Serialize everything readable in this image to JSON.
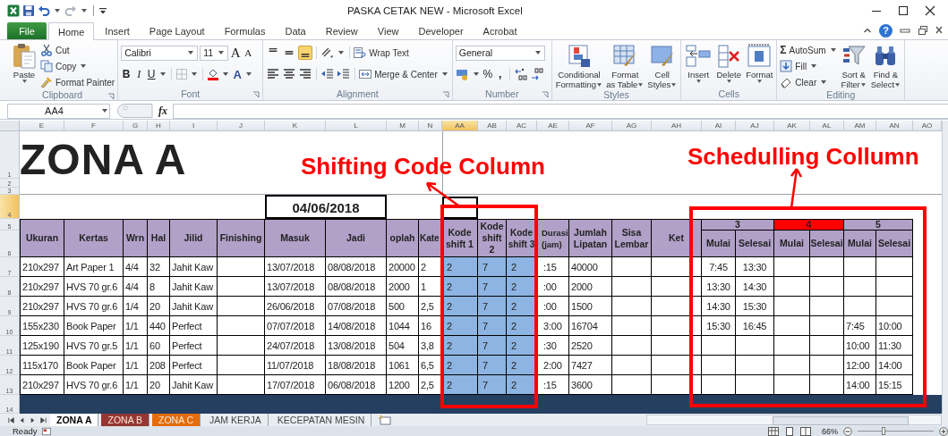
{
  "window": {
    "title": "PASKA CETAK NEW  -  Microsoft Excel"
  },
  "ribbon_tabs": [
    {
      "label": "File",
      "kind": "file",
      "selected": false
    },
    {
      "label": "Home",
      "kind": "tab",
      "selected": true
    },
    {
      "label": "Insert",
      "kind": "tab",
      "selected": false
    },
    {
      "label": "Page Layout",
      "kind": "tab",
      "selected": false
    },
    {
      "label": "Formulas",
      "kind": "tab",
      "selected": false
    },
    {
      "label": "Data",
      "kind": "tab",
      "selected": false
    },
    {
      "label": "Review",
      "kind": "tab",
      "selected": false
    },
    {
      "label": "View",
      "kind": "tab",
      "selected": false
    },
    {
      "label": "Developer",
      "kind": "tab",
      "selected": false
    },
    {
      "label": "Acrobat",
      "kind": "tab",
      "selected": false
    }
  ],
  "help": "?",
  "clipboard": {
    "label": "Clipboard",
    "paste": "Paste",
    "cut": "Cut",
    "copy": "Copy",
    "format_painter": "Format Painter"
  },
  "font": {
    "label": "Font",
    "name": "Calibri",
    "size": "11",
    "grow": "A",
    "shrink": "A",
    "bold": "B",
    "italic": "I",
    "underline": "U",
    "tint_letter": "A"
  },
  "alignment": {
    "label": "Alignment",
    "wrap_text": "Wrap Text",
    "merge": "Merge & Center",
    "vertical": [
      {
        "selected": false
      },
      {
        "selected": false
      },
      {
        "selected": true
      }
    ]
  },
  "number": {
    "label": "Number",
    "format": "General",
    "percent": "%",
    "comma": ","
  },
  "styles": {
    "label": "Styles",
    "buttons": [
      [
        "Conditional",
        "Formatting"
      ],
      [
        "Format",
        "as Table"
      ],
      [
        "Cell",
        "Styles"
      ]
    ]
  },
  "cells": {
    "label": "Cells",
    "buttons": [
      "Insert",
      "Delete",
      "Format"
    ]
  },
  "editing": {
    "label": "Editing",
    "sigma": "Σ",
    "autosum": "AutoSum",
    "fill": "Fill",
    "clear": "Clear",
    "buttons": [
      [
        "Sort &",
        "Filter"
      ],
      [
        "Find &",
        "Select"
      ]
    ]
  },
  "formula_bar": {
    "name_box": "AA4",
    "fx": "fx"
  },
  "sheet": {
    "columns": [
      {
        "label": "E",
        "selected": false
      },
      {
        "label": "F",
        "selected": false
      },
      {
        "label": "G",
        "selected": false
      },
      {
        "label": "H",
        "selected": false
      },
      {
        "label": "I",
        "selected": false
      },
      {
        "label": "J",
        "selected": false
      },
      {
        "label": "K",
        "selected": false
      },
      {
        "label": "L",
        "selected": false
      },
      {
        "label": "M",
        "selected": false
      },
      {
        "label": "N",
        "selected": false
      },
      {
        "label": "AA",
        "selected": true
      },
      {
        "label": "AB",
        "selected": false
      },
      {
        "label": "AC",
        "selected": false
      },
      {
        "label": "AE",
        "selected": false
      },
      {
        "label": "AF",
        "selected": false
      },
      {
        "label": "AG",
        "selected": false
      },
      {
        "label": "AH",
        "selected": false
      },
      {
        "label": "AI",
        "selected": false
      },
      {
        "label": "AJ",
        "selected": false
      },
      {
        "label": "AK",
        "selected": false
      },
      {
        "label": "AL",
        "selected": false
      },
      {
        "label": "AM",
        "selected": false
      },
      {
        "label": "AN",
        "selected": false
      },
      {
        "label": "AO",
        "selected": false
      }
    ],
    "rows": [
      {
        "label": "1",
        "selected": false
      },
      {
        "label": "2",
        "selected": false
      },
      {
        "label": "3",
        "selected": false
      },
      {
        "label": "4",
        "selected": true
      },
      {
        "label": "5",
        "selected": false
      },
      {
        "label": "6",
        "selected": false
      },
      {
        "label": "7",
        "selected": false
      },
      {
        "label": "8",
        "selected": false
      },
      {
        "label": "9",
        "selected": false
      },
      {
        "label": "10",
        "selected": false
      },
      {
        "label": "11",
        "selected": false
      },
      {
        "label": "12",
        "selected": false
      },
      {
        "label": "13",
        "selected": false
      },
      {
        "label": "14",
        "selected": false
      }
    ],
    "title": "ZONA A",
    "date": "04/06/2018",
    "headers": [
      "Ukuran",
      "Kertas",
      "Wrn",
      "Hal",
      "Jilid",
      "Finishing",
      "Masuk",
      "Jadi",
      "oplah",
      "Kate",
      "Kode shift 1",
      "Kode shift 2",
      "Kode shift 3",
      "Durasi (jam)",
      "Jumlah Lipatan",
      "Sisa Lembar",
      "Ket"
    ],
    "schedule_groups": [
      {
        "label": "3",
        "highlighted": false
      },
      {
        "label": "4",
        "highlighted": true
      },
      {
        "label": "5",
        "highlighted": false
      }
    ],
    "schedule_subheaders": [
      "Mulai",
      "Selesai",
      "Mulai",
      "Selesai",
      "Mulai",
      "Selesai"
    ],
    "data": [
      {
        "ukuran": "210x297",
        "kertas": "Art Paper 1",
        "wrn": "4/4",
        "hal": "32",
        "jilid": "Jahit Kaw",
        "masuk": "13/07/2018",
        "jadi": "08/08/2018",
        "oplah": "20000",
        "kate": "2",
        "kode_1": "2",
        "kode_2": "7",
        "kode_3": "2",
        "durasi": ":15",
        "lipatan": "40000",
        "s3_mulai": "7:45",
        "s3_selesai": "13:30"
      },
      {
        "ukuran": "210x297",
        "kertas": "HVS 70 gr.6",
        "wrn": "4/4",
        "hal": "8",
        "jilid": "Jahit Kaw",
        "masuk": "13/07/2018",
        "jadi": "08/08/2018",
        "oplah": "2000",
        "kate": "1",
        "kode_1": "2",
        "kode_2": "7",
        "kode_3": "2",
        "durasi": ":00",
        "lipatan": "2000",
        "s3_mulai": "13:30",
        "s3_selesai": "14:30"
      },
      {
        "ukuran": "210x297",
        "kertas": "HVS 70 gr.6",
        "wrn": "1/4",
        "hal": "20",
        "jilid": "Jahit Kaw",
        "masuk": "26/06/2018",
        "jadi": "07/08/2018",
        "oplah": "500",
        "kate": "2,5",
        "kode_1": "2",
        "kode_2": "7",
        "kode_3": "2",
        "durasi": ":00",
        "lipatan": "1500",
        "s3_mulai": "14:30",
        "s3_selesai": "15:30"
      },
      {
        "ukuran": "155x230",
        "kertas": "Book Paper",
        "wrn": "1/1",
        "hal": "440",
        "jilid": "Perfect",
        "masuk": "07/07/2018",
        "jadi": "14/08/2018",
        "oplah": "1044",
        "kate": "16",
        "kode_1": "2",
        "kode_2": "7",
        "kode_3": "2",
        "durasi": "3:00",
        "lipatan": "16704",
        "s3_mulai": "15:30",
        "s3_selesai": "16:45",
        "s5_mulai": "7:45",
        "s5_selesai": "10:00"
      },
      {
        "ukuran": "125x190",
        "kertas": "HVS 70 gr.5",
        "wrn": "1/1",
        "hal": "60",
        "jilid": "Perfect",
        "masuk": "24/07/2018",
        "jadi": "13/08/2018",
        "oplah": "504",
        "kate": "3,8",
        "kode_1": "2",
        "kode_2": "7",
        "kode_3": "2",
        "durasi": ":30",
        "lipatan": "2520",
        "s5_mulai": "10:00",
        "s5_selesai": "11:30"
      },
      {
        "ukuran": "115x170",
        "kertas": "Book Paper",
        "wrn": "1/1",
        "hal": "208",
        "jilid": "Perfect",
        "masuk": "11/07/2018",
        "jadi": "18/08/2018",
        "oplah": "1061",
        "kate": "6,5",
        "kode_1": "2",
        "kode_2": "7",
        "kode_3": "2",
        "durasi": "2:00",
        "lipatan": "7427",
        "s5_mulai": "12:00",
        "s5_selesai": "14:00"
      },
      {
        "ukuran": "210x297",
        "kertas": "HVS 70 gr.6",
        "wrn": "1/1",
        "hal": "20",
        "jilid": "Jahit Kaw",
        "masuk": "17/07/2018",
        "jadi": "06/08/2018",
        "oplah": "1200",
        "kate": "2,5",
        "kode_1": "2",
        "kode_2": "7",
        "kode_3": "2",
        "durasi": ":15",
        "lipatan": "3600",
        "s5_mulai": "14:00",
        "s5_selesai": "15:15"
      }
    ]
  },
  "annotations": [
    "Shifting Code Column",
    "Schedulling Collumn"
  ],
  "sheet_tabs": [
    {
      "label": "ZONA A",
      "selected": true
    },
    {
      "label": "ZONA B",
      "selected": false,
      "color": "#953735"
    },
    {
      "label": "ZONA C",
      "selected": false,
      "color": "#e46c0a"
    },
    {
      "label": "JAM KERJA",
      "selected": false
    },
    {
      "label": "KECEPATAN MESIN",
      "selected": false
    }
  ],
  "status_bar": {
    "mode": "Ready",
    "zoom": "66%",
    "zoom_slider": {
      "level": 0.34
    }
  }
}
